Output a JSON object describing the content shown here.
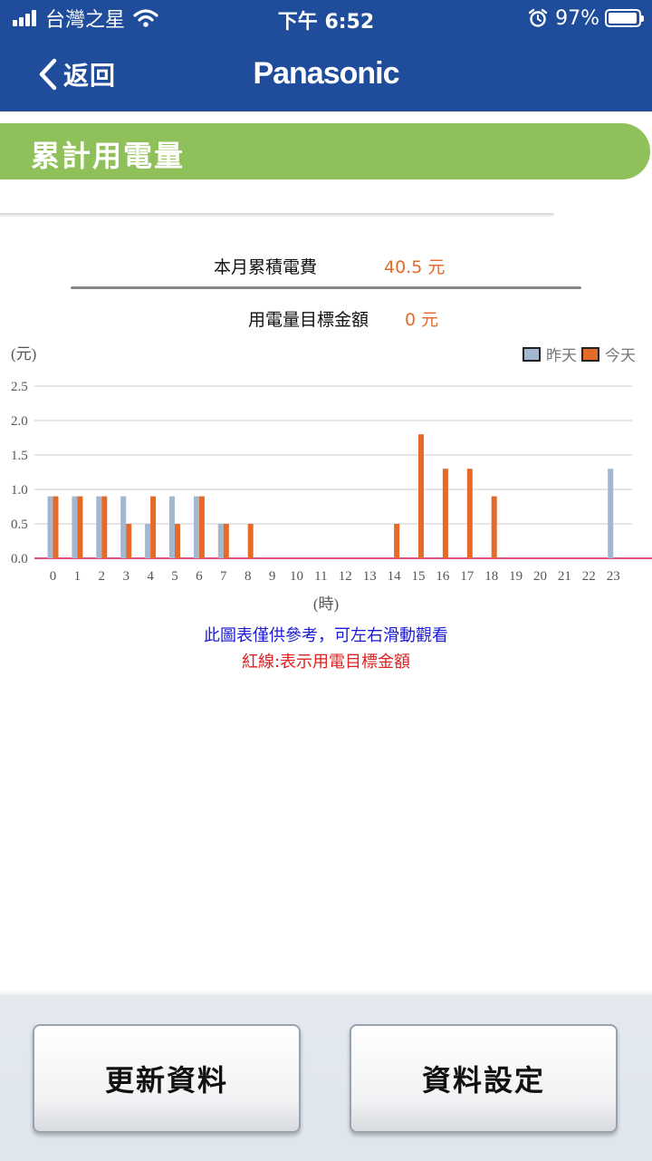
{
  "status_bar": {
    "carrier": "台灣之星",
    "time": "下午 6:52",
    "battery_percent": "97%",
    "battery_level": 0.97,
    "icons": [
      "signal-icon",
      "wifi-icon",
      "alarm-icon",
      "battery-icon"
    ]
  },
  "nav": {
    "back_label": "返回",
    "brand": "Panasonic",
    "colors": {
      "bar": "#1f4d9b",
      "text": "#ffffff"
    }
  },
  "section": {
    "title": "累計用電量",
    "color": "#8fc05a"
  },
  "summary": {
    "month_cost_label": "本月累積電費",
    "month_cost_value": "40.5 元",
    "target_label": "用電量目標金額",
    "target_value": "0 元",
    "value_color": "#e46a2a"
  },
  "chart_data": {
    "type": "bar",
    "y_unit_label": "(元)",
    "x_unit_label": "(時)",
    "categories": [
      "0",
      "1",
      "2",
      "3",
      "4",
      "5",
      "6",
      "7",
      "8",
      "9",
      "10",
      "11",
      "12",
      "13",
      "14",
      "15",
      "16",
      "17",
      "18",
      "19",
      "20",
      "21",
      "22",
      "23"
    ],
    "series": [
      {
        "name": "昨天",
        "color": "#a3b7d0",
        "values": [
          0.9,
          0.9,
          0.9,
          0.9,
          0.5,
          0.9,
          0.9,
          0.5,
          0,
          0,
          0,
          0,
          0,
          0,
          0,
          0,
          0,
          0,
          0,
          0,
          0,
          0,
          0,
          1.3
        ]
      },
      {
        "name": "今天",
        "color": "#e46a2a",
        "values": [
          0.9,
          0.9,
          0.9,
          0.5,
          0.9,
          0.5,
          0.9,
          0.5,
          0.5,
          0,
          0,
          0,
          0,
          0,
          0.5,
          1.8,
          1.3,
          1.3,
          0.9,
          0,
          0,
          0,
          0,
          0
        ]
      }
    ],
    "ylim": [
      0,
      2.5
    ],
    "yticks": [
      "0.0",
      "0.5",
      "1.0",
      "1.5",
      "2.0",
      "2.5"
    ],
    "target_line": {
      "value": 0,
      "color": "#e0507a"
    },
    "grid": true,
    "legend": "top-right"
  },
  "notes": {
    "reference": "此圖表僅供參考，可左右滑動觀看",
    "red_line": "紅線:表示用電目標金額"
  },
  "buttons": {
    "refresh": "更新資料",
    "settings": "資料設定"
  }
}
